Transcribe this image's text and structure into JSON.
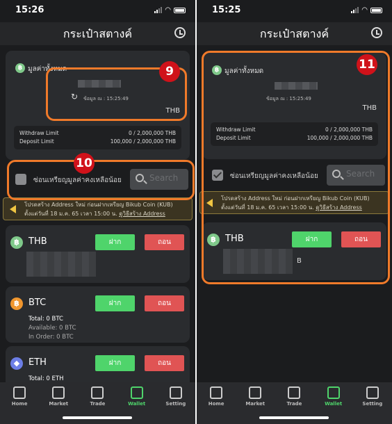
{
  "colors": {
    "deposit": "#4fd46b",
    "withdraw": "#e05454",
    "accent": "#4fd46b",
    "annotation_outline": "#f07a2a",
    "annotation_badge": "#d0121a"
  },
  "screens": [
    {
      "time": "15:26",
      "title": "กระเป๋าสตางค์",
      "total_label": "มูลค่าทั้งหมด",
      "updated": "ข้อมูล ณ : 15:25:49",
      "currency": "THB",
      "withdraw_limit_label": "Withdraw Limit",
      "withdraw_limit": "0 / 2,000,000 THB",
      "deposit_limit_label": "Deposit Limit",
      "deposit_limit": "100,000 / 2,000,000 THB",
      "hide_small_label": "ซ่อนเหรียญมูลค่าคงเหลือน้อย",
      "hide_small_checked": false,
      "search_placeholder": "Search",
      "notice_line1": "โปรดสร้าง Address ใหม่ ก่อนฝากเหรียญ Bikub Coin (KUB)",
      "notice_line2": "ตั้งแต่วันที่ 18 ม.ค. 65 เวลา 15:00 น.",
      "notice_link": "ดูวิธีสร้าง Address",
      "coins": [
        {
          "symbol": "THB",
          "icon": "baht-icon",
          "color": "#7fc98a",
          "deposit": "ฝาก",
          "withdraw": "ถอน"
        },
        {
          "symbol": "BTC",
          "icon": "bitcoin-icon",
          "color": "#f0962e",
          "deposit": "ฝาก",
          "withdraw": "ถอน",
          "total": "Total: 0 BTC",
          "available": "Available: 0 BTC",
          "in_order": "In Order: 0 BTC"
        },
        {
          "symbol": "ETH",
          "icon": "ethereum-icon",
          "color": "#6c7ee6",
          "deposit": "ฝาก",
          "withdraw": "ถอน",
          "total": "Total: 0 ETH"
        }
      ],
      "annotations": [
        "9",
        "10"
      ]
    },
    {
      "time": "15:25",
      "title": "กระเป๋าสตางค์",
      "total_label": "มูลค่าทั้งหมด",
      "updated": "ข้อมูล ณ : 15:25:49",
      "currency": "THB",
      "withdraw_limit_label": "Withdraw Limit",
      "withdraw_limit": "0 / 2,000,000 THB",
      "deposit_limit_label": "Deposit Limit",
      "deposit_limit": "100,000 / 2,000,000 THB",
      "hide_small_label": "ซ่อนเหรียญมูลค่าคงเหลือน้อย",
      "hide_small_checked": true,
      "search_placeholder": "Search",
      "notice_line1": "โปรดสร้าง Address ใหม่ ก่อนฝากเหรียญ Bikub Coin (KUB)",
      "notice_line2": "ตั้งแต่วันที่ 18 ม.ค. 65 เวลา 15:00 น.",
      "notice_link": "ดูวิธีสร้าง Address",
      "coins": [
        {
          "symbol": "THB",
          "icon": "baht-icon",
          "color": "#7fc98a",
          "deposit": "ฝาก",
          "withdraw": "ถอน",
          "balance_suffix": "B"
        }
      ],
      "annotations": [
        "11"
      ]
    }
  ],
  "nav": [
    {
      "label": "Home",
      "icon": "home-icon"
    },
    {
      "label": "Market",
      "icon": "chart-icon"
    },
    {
      "label": "Trade",
      "icon": "trade-icon"
    },
    {
      "label": "Wallet",
      "icon": "wallet-icon",
      "active": true
    },
    {
      "label": "Setting",
      "icon": "user-icon"
    }
  ]
}
